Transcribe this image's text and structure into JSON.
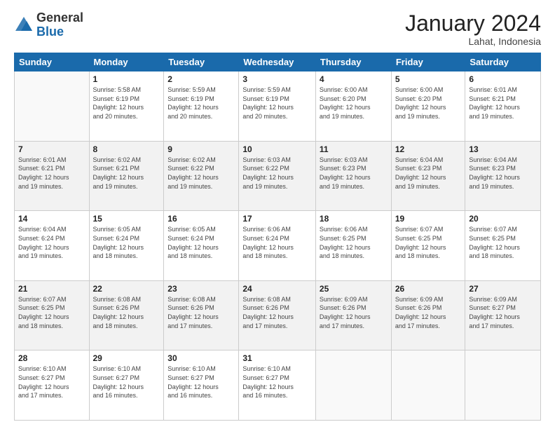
{
  "header": {
    "logo_general": "General",
    "logo_blue": "Blue",
    "month_title": "January 2024",
    "subtitle": "Lahat, Indonesia"
  },
  "days_of_week": [
    "Sunday",
    "Monday",
    "Tuesday",
    "Wednesday",
    "Thursday",
    "Friday",
    "Saturday"
  ],
  "weeks": [
    {
      "shaded": false,
      "days": [
        {
          "num": "",
          "info": ""
        },
        {
          "num": "1",
          "info": "Sunrise: 5:58 AM\nSunset: 6:19 PM\nDaylight: 12 hours\nand 20 minutes."
        },
        {
          "num": "2",
          "info": "Sunrise: 5:59 AM\nSunset: 6:19 PM\nDaylight: 12 hours\nand 20 minutes."
        },
        {
          "num": "3",
          "info": "Sunrise: 5:59 AM\nSunset: 6:19 PM\nDaylight: 12 hours\nand 20 minutes."
        },
        {
          "num": "4",
          "info": "Sunrise: 6:00 AM\nSunset: 6:20 PM\nDaylight: 12 hours\nand 19 minutes."
        },
        {
          "num": "5",
          "info": "Sunrise: 6:00 AM\nSunset: 6:20 PM\nDaylight: 12 hours\nand 19 minutes."
        },
        {
          "num": "6",
          "info": "Sunrise: 6:01 AM\nSunset: 6:21 PM\nDaylight: 12 hours\nand 19 minutes."
        }
      ]
    },
    {
      "shaded": true,
      "days": [
        {
          "num": "7",
          "info": "Sunrise: 6:01 AM\nSunset: 6:21 PM\nDaylight: 12 hours\nand 19 minutes."
        },
        {
          "num": "8",
          "info": "Sunrise: 6:02 AM\nSunset: 6:21 PM\nDaylight: 12 hours\nand 19 minutes."
        },
        {
          "num": "9",
          "info": "Sunrise: 6:02 AM\nSunset: 6:22 PM\nDaylight: 12 hours\nand 19 minutes."
        },
        {
          "num": "10",
          "info": "Sunrise: 6:03 AM\nSunset: 6:22 PM\nDaylight: 12 hours\nand 19 minutes."
        },
        {
          "num": "11",
          "info": "Sunrise: 6:03 AM\nSunset: 6:23 PM\nDaylight: 12 hours\nand 19 minutes."
        },
        {
          "num": "12",
          "info": "Sunrise: 6:04 AM\nSunset: 6:23 PM\nDaylight: 12 hours\nand 19 minutes."
        },
        {
          "num": "13",
          "info": "Sunrise: 6:04 AM\nSunset: 6:23 PM\nDaylight: 12 hours\nand 19 minutes."
        }
      ]
    },
    {
      "shaded": false,
      "days": [
        {
          "num": "14",
          "info": "Sunrise: 6:04 AM\nSunset: 6:24 PM\nDaylight: 12 hours\nand 19 minutes."
        },
        {
          "num": "15",
          "info": "Sunrise: 6:05 AM\nSunset: 6:24 PM\nDaylight: 12 hours\nand 18 minutes."
        },
        {
          "num": "16",
          "info": "Sunrise: 6:05 AM\nSunset: 6:24 PM\nDaylight: 12 hours\nand 18 minutes."
        },
        {
          "num": "17",
          "info": "Sunrise: 6:06 AM\nSunset: 6:24 PM\nDaylight: 12 hours\nand 18 minutes."
        },
        {
          "num": "18",
          "info": "Sunrise: 6:06 AM\nSunset: 6:25 PM\nDaylight: 12 hours\nand 18 minutes."
        },
        {
          "num": "19",
          "info": "Sunrise: 6:07 AM\nSunset: 6:25 PM\nDaylight: 12 hours\nand 18 minutes."
        },
        {
          "num": "20",
          "info": "Sunrise: 6:07 AM\nSunset: 6:25 PM\nDaylight: 12 hours\nand 18 minutes."
        }
      ]
    },
    {
      "shaded": true,
      "days": [
        {
          "num": "21",
          "info": "Sunrise: 6:07 AM\nSunset: 6:25 PM\nDaylight: 12 hours\nand 18 minutes."
        },
        {
          "num": "22",
          "info": "Sunrise: 6:08 AM\nSunset: 6:26 PM\nDaylight: 12 hours\nand 18 minutes."
        },
        {
          "num": "23",
          "info": "Sunrise: 6:08 AM\nSunset: 6:26 PM\nDaylight: 12 hours\nand 17 minutes."
        },
        {
          "num": "24",
          "info": "Sunrise: 6:08 AM\nSunset: 6:26 PM\nDaylight: 12 hours\nand 17 minutes."
        },
        {
          "num": "25",
          "info": "Sunrise: 6:09 AM\nSunset: 6:26 PM\nDaylight: 12 hours\nand 17 minutes."
        },
        {
          "num": "26",
          "info": "Sunrise: 6:09 AM\nSunset: 6:26 PM\nDaylight: 12 hours\nand 17 minutes."
        },
        {
          "num": "27",
          "info": "Sunrise: 6:09 AM\nSunset: 6:27 PM\nDaylight: 12 hours\nand 17 minutes."
        }
      ]
    },
    {
      "shaded": false,
      "days": [
        {
          "num": "28",
          "info": "Sunrise: 6:10 AM\nSunset: 6:27 PM\nDaylight: 12 hours\nand 17 minutes."
        },
        {
          "num": "29",
          "info": "Sunrise: 6:10 AM\nSunset: 6:27 PM\nDaylight: 12 hours\nand 16 minutes."
        },
        {
          "num": "30",
          "info": "Sunrise: 6:10 AM\nSunset: 6:27 PM\nDaylight: 12 hours\nand 16 minutes."
        },
        {
          "num": "31",
          "info": "Sunrise: 6:10 AM\nSunset: 6:27 PM\nDaylight: 12 hours\nand 16 minutes."
        },
        {
          "num": "",
          "info": ""
        },
        {
          "num": "",
          "info": ""
        },
        {
          "num": "",
          "info": ""
        }
      ]
    }
  ]
}
